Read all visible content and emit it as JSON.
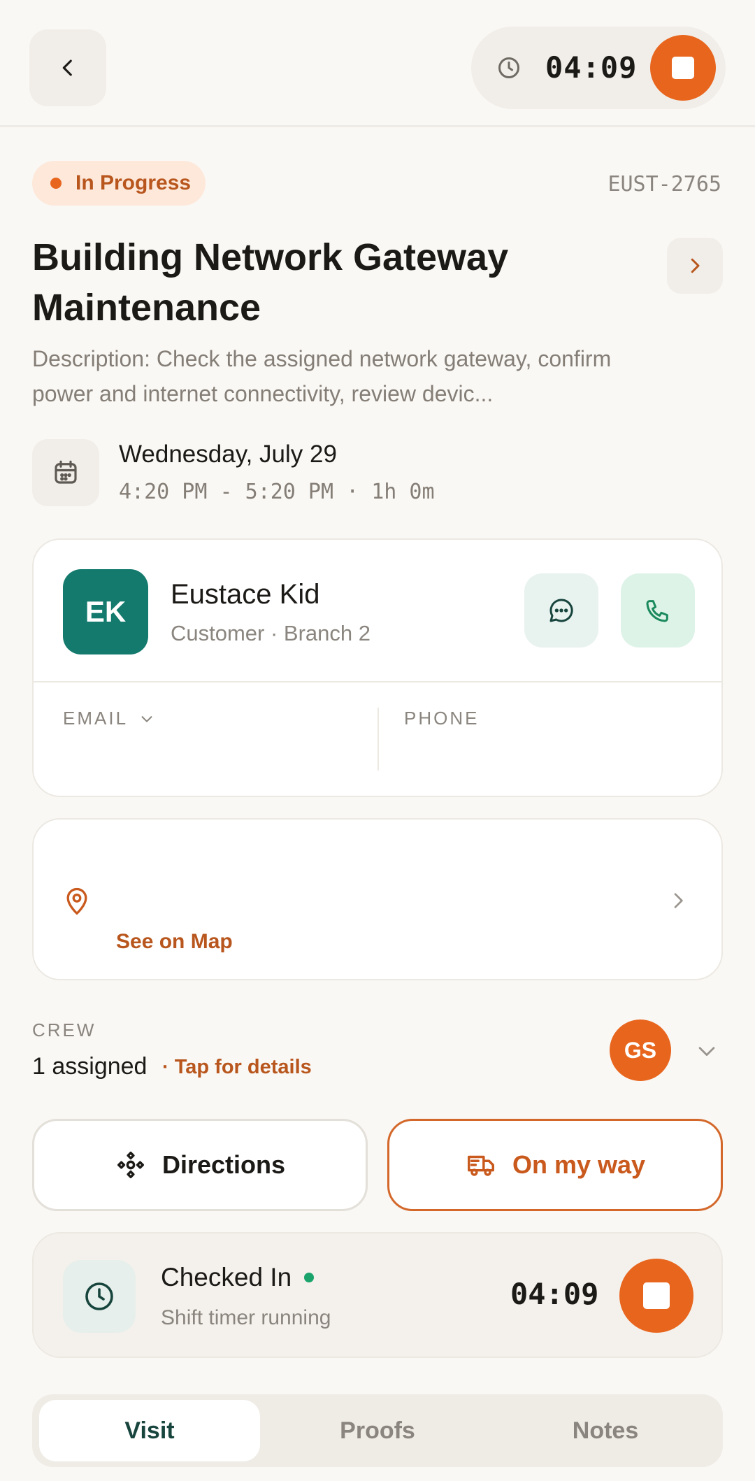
{
  "header": {
    "timer": "04:09"
  },
  "job": {
    "status": "In Progress",
    "id": "EUST-2765",
    "title": "Building Network Gateway Maintenance",
    "description": "Description: Check the assigned network gateway, confirm power and internet connectivity, review devic...",
    "date": "Wednesday, July 29",
    "time_range": "4:20 PM - 5:20 PM · 1h 0m"
  },
  "customer": {
    "initials": "EK",
    "name": "Eustace Kid",
    "subtitle": "Customer · Branch 2",
    "email_label": "EMAIL",
    "phone_label": "PHONE"
  },
  "location": {
    "map_link": "See on Map"
  },
  "crew": {
    "label": "CREW",
    "count": "1 assigned",
    "tap_hint": "· Tap for details",
    "avatar_initials": "GS"
  },
  "actions": {
    "directions": "Directions",
    "on_my_way": "On my way"
  },
  "checkin": {
    "title": "Checked In",
    "subtitle": "Shift timer running",
    "timer": "04:09"
  },
  "tabs": [
    {
      "label": "Visit",
      "active": true
    },
    {
      "label": "Proofs",
      "active": false
    },
    {
      "label": "Notes",
      "active": false
    }
  ],
  "colors": {
    "accent": "#e8651d",
    "teal": "#137a6d",
    "background": "#faf8f5"
  }
}
